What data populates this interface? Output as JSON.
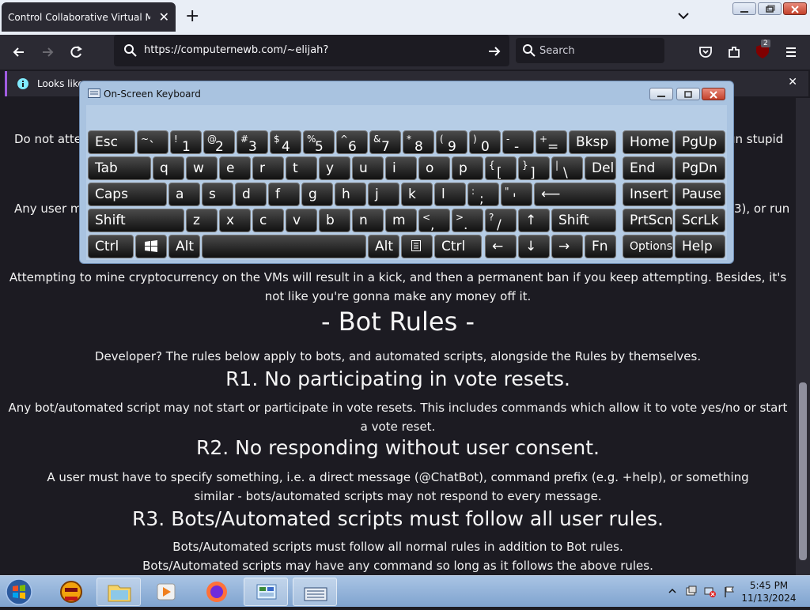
{
  "tab": {
    "title": "Control Collaborative Virtual Machin",
    "close": "✕"
  },
  "new_tab": "+",
  "url": "https://computernewb.com/~elijah?",
  "search_placeholder": "Search",
  "extension_badge": "2",
  "notification": {
    "text": "Looks like",
    "close": "✕"
  },
  "page": {
    "line1_left": "Do not atte",
    "line1_right": "un stupid",
    "line2_left": "Any user m",
    "line2_right": "3), or run",
    "mining_text": "Attempting to mine cryptocurrency on the VMs will result in a kick, and then a permanent ban if you keep attempting. Besides, it's not like you're gonna make any money off it.",
    "bot_rules_title": "- Bot Rules -",
    "bot_rules_intro": "Developer? The rules below apply to bots, and automated scripts, alongside the Rules by themselves.",
    "r1_title": "R1. No participating in vote resets.",
    "r1_text": "Any bot/automated script may not start or participate in vote resets. This includes commands which allow it to vote yes/no or start a vote reset.",
    "r2_title": "R2. No responding without user consent.",
    "r2_text": "A user must have to specify something, i.e. a direct message (@ChatBot), command prefix (e.g. +help), or something similar - bots/automated scripts may not respond to every message.",
    "r3_title": "R3. Bots/Automated scripts must follow all user rules.",
    "r3_text1": "Bots/Automated scripts must follow all normal rules in addition to Bot rules.",
    "r3_text2": "Bots/Automated scripts may have any command so long as it follows the above rules."
  },
  "osk": {
    "title": "On-Screen Keyboard",
    "keys": {
      "esc": "Esc",
      "tilde_sup": "~",
      "tilde_main": "`",
      "k1_sup": "!",
      "k1": "1",
      "k2_sup": "@",
      "k2": "2",
      "k3_sup": "#",
      "k3": "3",
      "k4_sup": "$",
      "k4": "4",
      "k5_sup": "%",
      "k5": "5",
      "k6_sup": "^",
      "k6": "6",
      "k7_sup": "&",
      "k7": "7",
      "k8_sup": "*",
      "k8": "8",
      "k9_sup": "(",
      "k9": "9",
      "k0_sup": ")",
      "k0": "0",
      "minus_sup": "-",
      "minus": "-",
      "plus_sup": "+",
      "equals": "=",
      "bksp": "Bksp",
      "home": "Home",
      "pgup": "PgUp",
      "tab": "Tab",
      "q": "q",
      "w": "w",
      "e": "e",
      "r": "r",
      "t": "t",
      "y": "y",
      "u": "u",
      "i": "i",
      "o": "o",
      "p": "p",
      "lbr_sup": "{",
      "lbr": "[",
      "rbr_sup": "}",
      "rbr": "]",
      "bsl_sup": "|",
      "bsl": "\\",
      "del": "Del",
      "end": "End",
      "pgdn": "PgDn",
      "caps": "Caps",
      "a": "a",
      "s": "s",
      "d": "d",
      "f": "f",
      "g": "g",
      "h": "h",
      "j": "j",
      "k": "k",
      "l": "l",
      "semi_sup": ":",
      "semi": ";",
      "quote_sup": "\"",
      "quote": "'",
      "enter": "⟵",
      "insert": "Insert",
      "pause": "Pause",
      "shift_l": "Shift",
      "z": "z",
      "x": "x",
      "c": "c",
      "v": "v",
      "b": "b",
      "n": "n",
      "m": "m",
      "comma_sup": "<",
      "comma": ",",
      "period_sup": ">",
      "period": ".",
      "slash_sup": "?",
      "slash": "/",
      "up": "↑",
      "shift_r": "Shift",
      "prtscn": "PrtScn",
      "scrlk": "ScrLk",
      "ctrl_l": "Ctrl",
      "alt_l": "Alt",
      "alt_r": "Alt",
      "ctrl_r": "Ctrl",
      "left": "←",
      "down": "↓",
      "right": "→",
      "fn": "Fn",
      "options": "Options",
      "help": "Help"
    }
  },
  "clock": {
    "time": "5:45 PM",
    "date": "11/13/2024"
  }
}
